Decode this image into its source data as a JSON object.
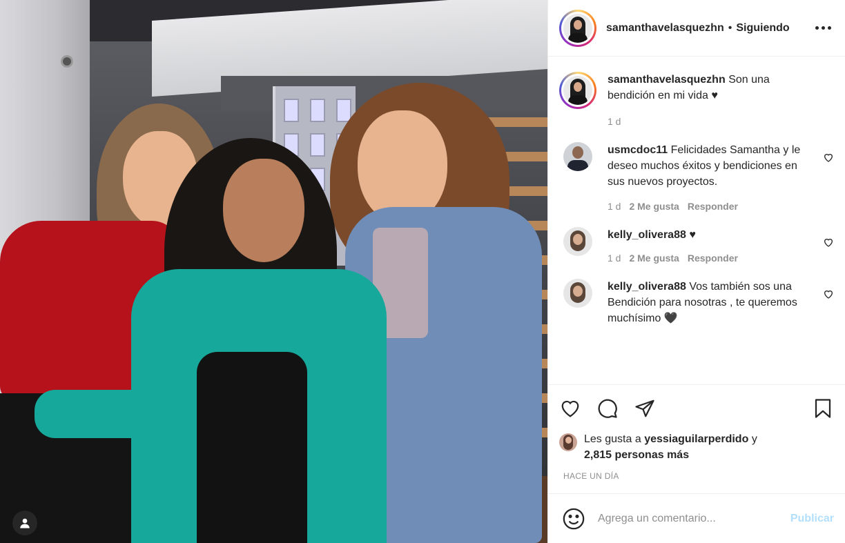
{
  "post": {
    "photo_icon": "user-tag-icon"
  },
  "header": {
    "username": "samanthavelasquezhn",
    "separator": "•",
    "follow_status": "Siguiendo",
    "more_icon": "more-options-icon"
  },
  "caption": {
    "username": "samanthavelasquezhn",
    "text": "Son una bendición en mi vida",
    "emoji": "♥",
    "time": "1 d"
  },
  "comments": [
    {
      "username": "usmcdoc11",
      "text": "Felicidades Samantha y le deseo muchos éxitos y bendiciones en sus nuevos proyectos.",
      "time": "1 d",
      "likes": "2 Me gusta",
      "reply": "Responder"
    },
    {
      "username": "kelly_olivera88",
      "text": "♥",
      "time": "1 d",
      "likes": "2 Me gusta",
      "reply": "Responder"
    },
    {
      "username": "kelly_olivera88",
      "text": "Vos también sos una Bendición para nosotras , te queremos muchísimo 🖤"
    }
  ],
  "actions": {
    "like_icon": "heart-icon",
    "comment_icon": "comment-icon",
    "share_icon": "paper-plane-icon",
    "save_icon": "bookmark-icon"
  },
  "likes": {
    "prefix": "Les gusta a",
    "user": "yessiaguilarperdido",
    "connector": "y",
    "count": "2,815 personas más"
  },
  "timestamp": "HACE UN DÍA",
  "add_comment": {
    "placeholder": "Agrega un comentario...",
    "publish_label": "Publicar",
    "emoji_icon": "smiley-icon"
  },
  "colors": {
    "text": "#262626",
    "muted": "#8e8e8e",
    "publish_disabled": "#b2dffc",
    "border": "#efefef"
  }
}
